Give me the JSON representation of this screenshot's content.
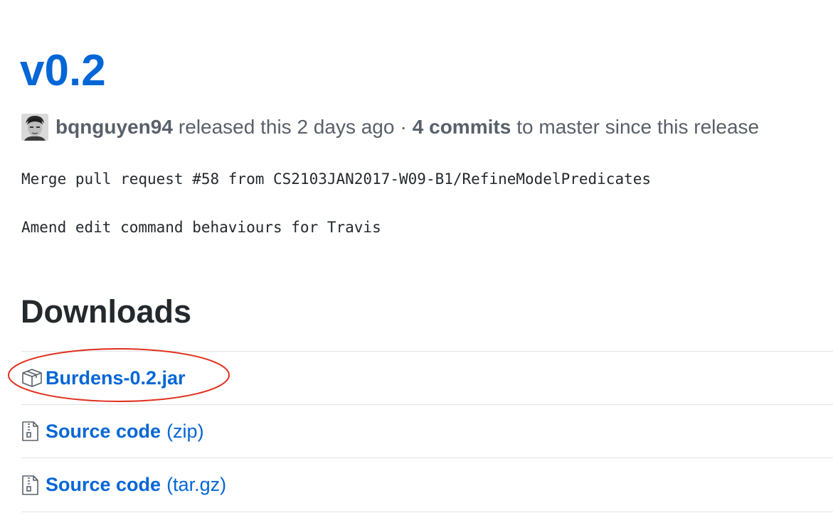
{
  "release": {
    "tag": "v0.2",
    "author": "bqnguyen94",
    "released_text": "released this 2 days ago",
    "separator": "·",
    "commits": "4 commits",
    "commits_suffix": "to master since this release"
  },
  "notes": {
    "line1": "Merge pull request #58 from CS2103JAN2017-W09-B1/RefineModelPredicates",
    "line2": "Amend edit command behaviours for Travis"
  },
  "downloads": {
    "heading": "Downloads",
    "items": [
      {
        "name": "Burdens-0.2.jar",
        "ext": "",
        "icon": "package-icon"
      },
      {
        "name": "Source code",
        "ext": "(zip)",
        "icon": "file-zip-icon"
      },
      {
        "name": "Source code",
        "ext": "(tar.gz)",
        "icon": "file-zip-icon"
      }
    ]
  },
  "colors": {
    "link": "#0366d6",
    "text": "#24292e",
    "muted": "#586069",
    "border": "#e1e4e8",
    "annotation": "#e0301e"
  }
}
